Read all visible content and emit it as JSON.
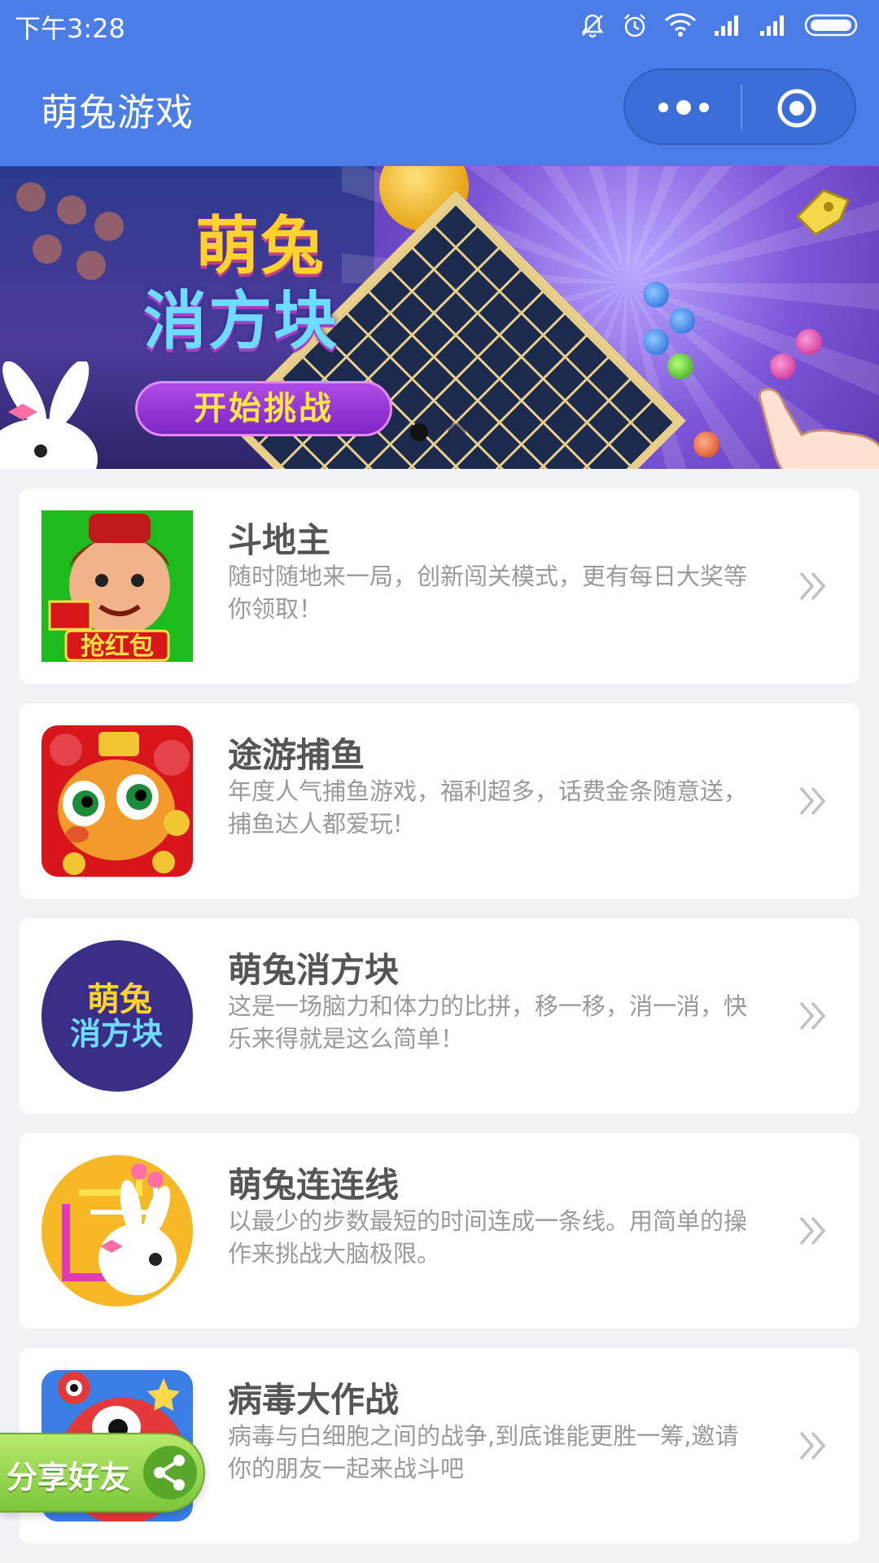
{
  "status_bar": {
    "time": "下午3:28",
    "icons": [
      "bell-off-icon",
      "alarm-icon",
      "wifi-icon",
      "signal-icon",
      "signal-icon",
      "battery-icon"
    ]
  },
  "navbar": {
    "title": "萌兔游戏",
    "capsule": {
      "more_icon": "more-dots-icon",
      "close_icon": "target-close-icon"
    },
    "color": "#4a7ee6"
  },
  "banner": {
    "logo_line1": "萌兔",
    "logo_line2": "消方块",
    "button_label": "开始挑战",
    "page_count": 2,
    "active_page": 0
  },
  "games": [
    {
      "name": "斗地主",
      "desc": "随时随地来一局，创新闯关模式，更有每日大奖等你领取！",
      "thumb_text": "抢红包"
    },
    {
      "name": "途游捕鱼",
      "desc": "年度人气捕鱼游戏，福利超多，话费金条随意送，捕鱼达人都爱玩!",
      "thumb_text": ""
    },
    {
      "name": "萌兔消方块",
      "desc": "这是一场脑力和体力的比拼，移一移，消一消，快乐来得就是这么简单！",
      "thumb_text_1": "萌兔",
      "thumb_text_2": "消方块"
    },
    {
      "name": "萌兔连连线",
      "desc": "以最少的步数最短的时间连成一条线。用简单的操作来挑战大脑极限。",
      "thumb_text": ""
    },
    {
      "name": "病毒大作战",
      "desc": "病毒与白细胞之间的战争,到底谁能更胜一筹,邀请你的朋友一起来战斗吧",
      "thumb_text": ""
    }
  ],
  "share_button": {
    "label": "分享好友",
    "icon": "share-icon"
  }
}
